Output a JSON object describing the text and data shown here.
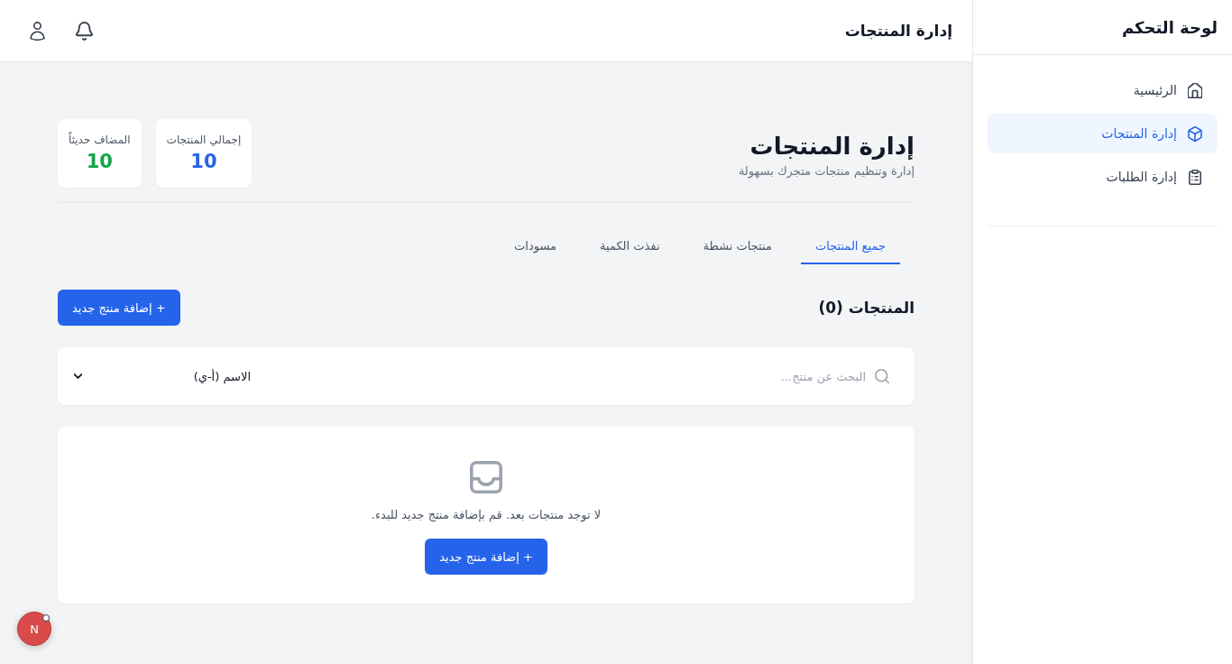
{
  "sidebar": {
    "title": "لوحة التحكم",
    "items": [
      {
        "label": "الرئيسية",
        "selected": false
      },
      {
        "label": "إدارة المنتجات",
        "selected": true
      },
      {
        "label": "إدارة الطلبات",
        "selected": false
      }
    ]
  },
  "top_bar": {
    "title": "إدارة المنتجات"
  },
  "header": {
    "title": "إدارة المنتجات",
    "subtitle": "إدارة وتنظيم منتجات متجرك بسهولة",
    "stats": [
      {
        "label": "إجمالي المنتجات",
        "value": "10",
        "color": "#2563eb"
      },
      {
        "label": "المضاف حديثاً",
        "value": "10",
        "color": "#16a34a"
      }
    ]
  },
  "tabs": [
    {
      "label": "جميع المنتجات",
      "selected": true
    },
    {
      "label": "منتجات نشطة",
      "selected": false
    },
    {
      "label": "نفذت الكمية",
      "selected": false
    },
    {
      "label": "مسودات",
      "selected": false
    }
  ],
  "products": {
    "title": "المنتجات (0)",
    "add_button": "+ إضافة منتج جديد"
  },
  "filters": {
    "search": {
      "placeholder": "البحث عن منتج..."
    },
    "sort": {
      "value": "الاسم (أ-ي)"
    }
  },
  "empty_state": {
    "message": "لا توجد منتجات بعد. قم بإضافة منتج جديد للبدء.",
    "button": "+ إضافة منتج جديد"
  },
  "dev_badge": {
    "label": "N"
  }
}
